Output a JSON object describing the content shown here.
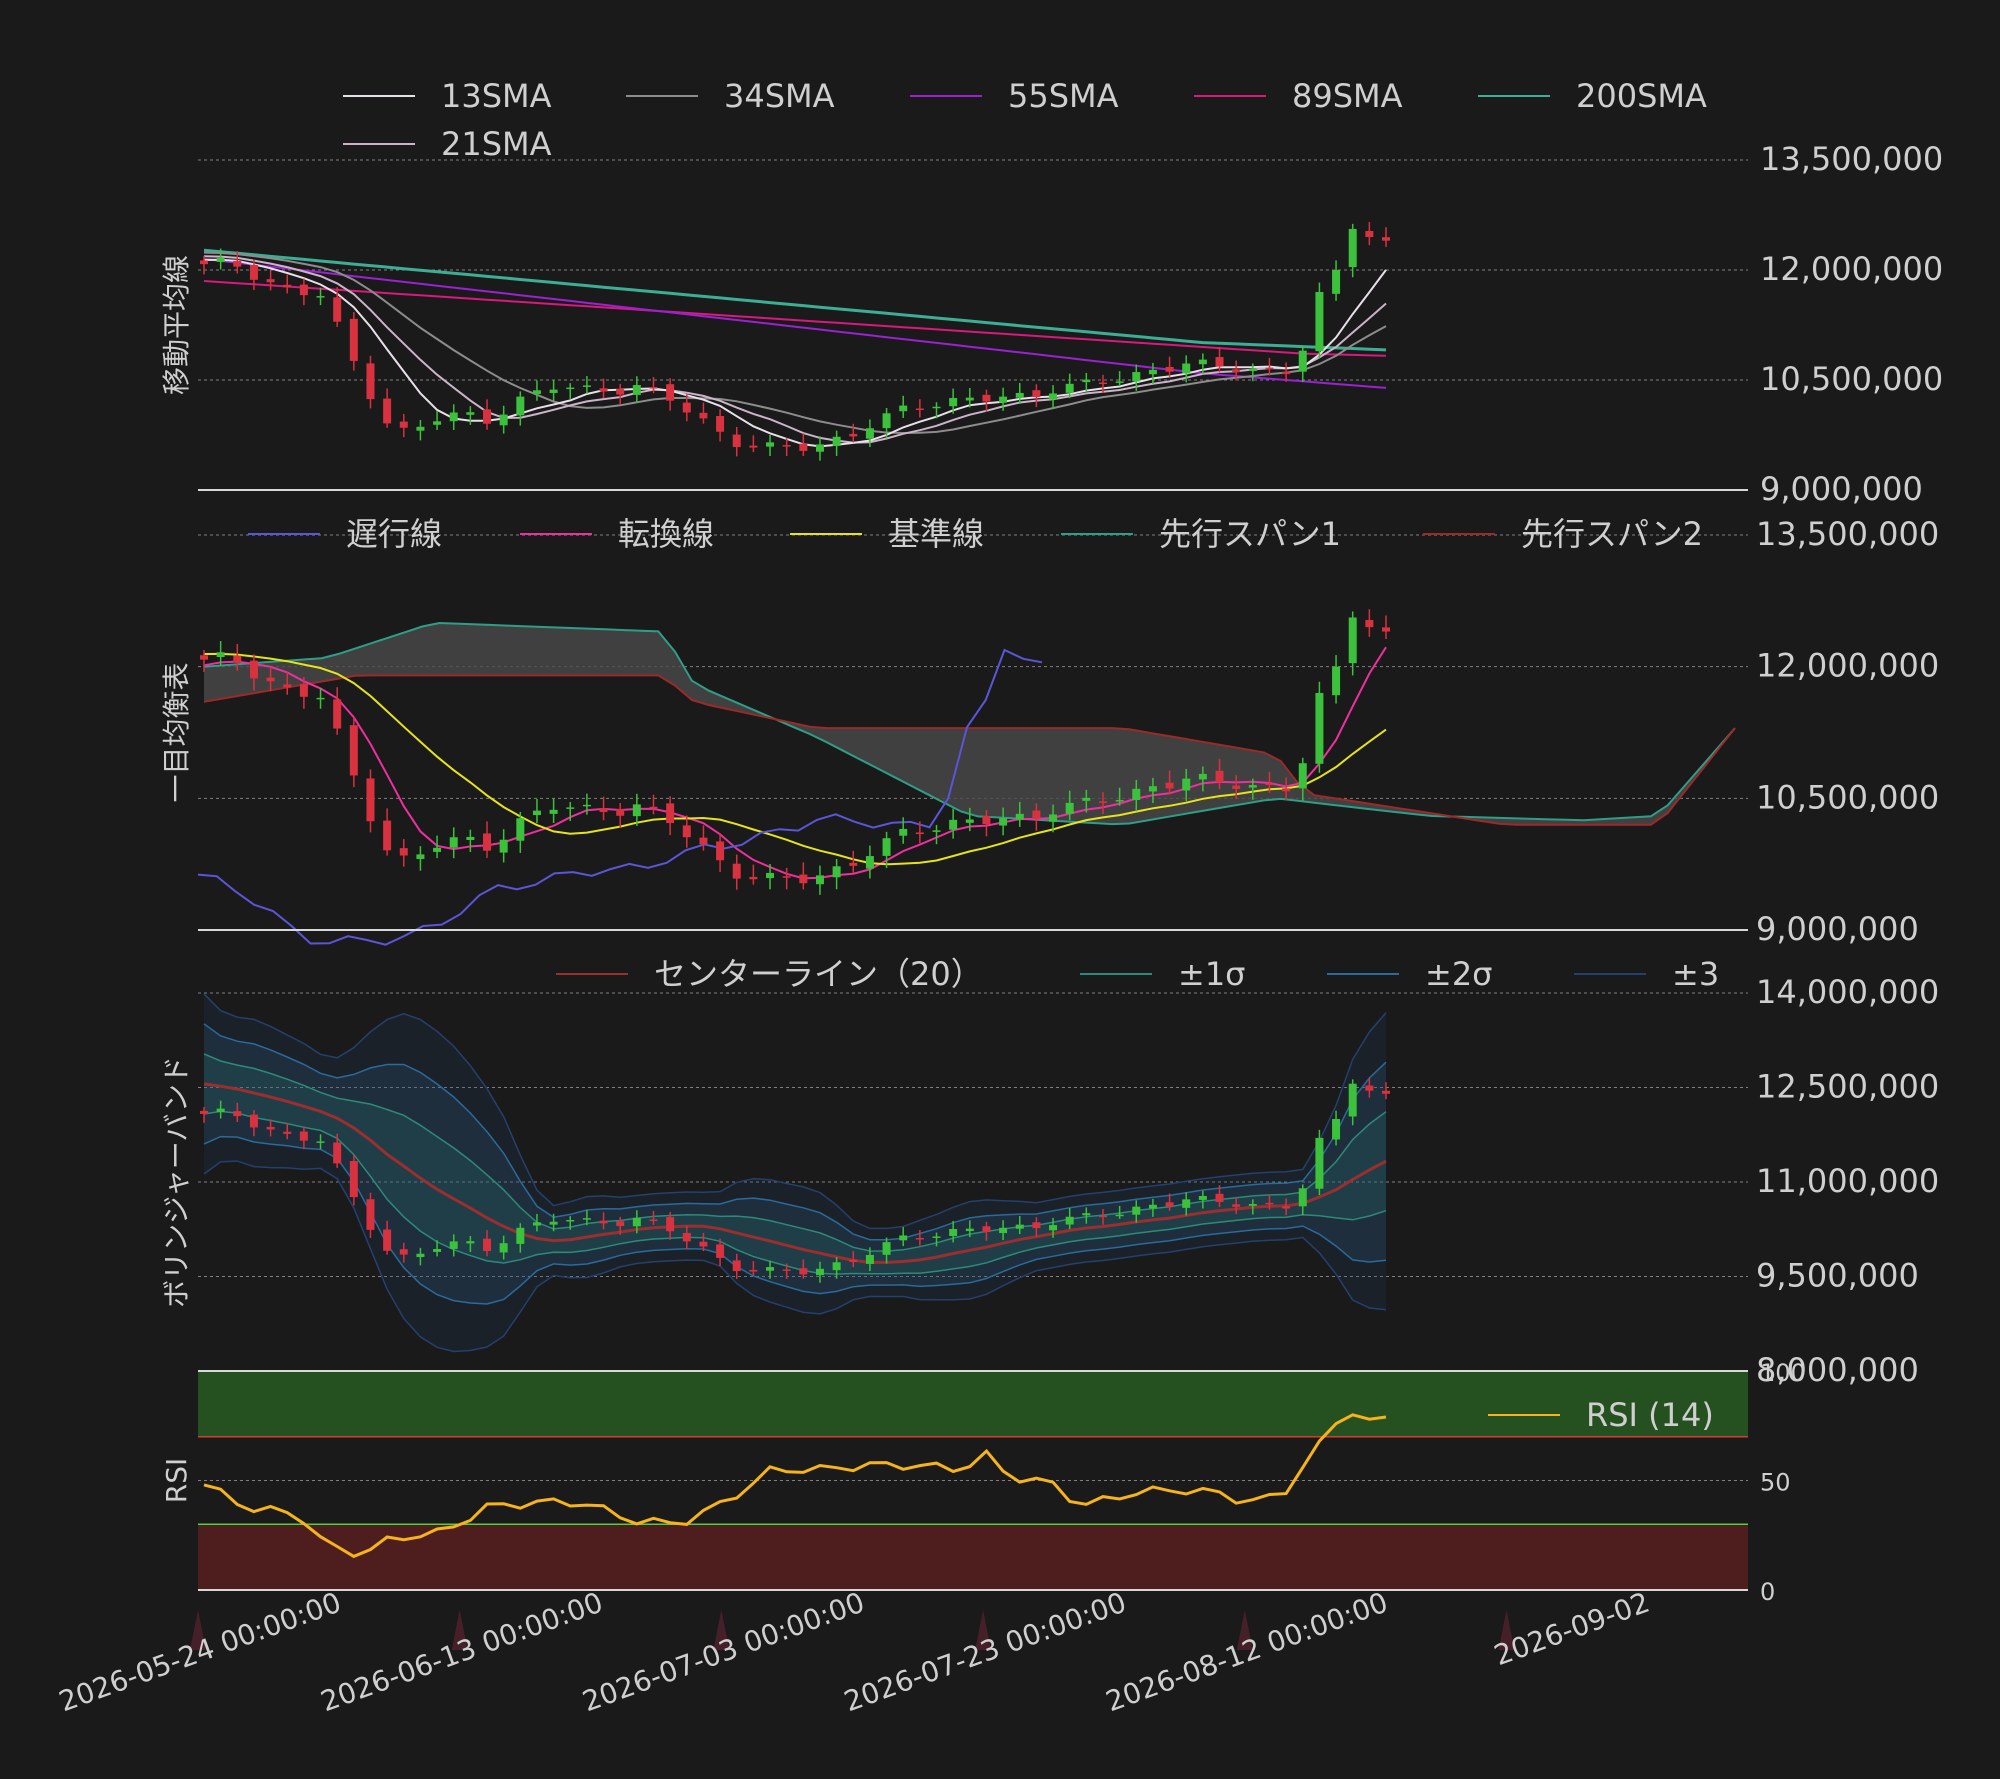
{
  "colors": {
    "background": "#1a1a1a",
    "text": "#cfcfcf",
    "grid": "#9a9a9a",
    "up": "#3cc13c",
    "down": "#d8313f",
    "sma13": "#e8e0e8",
    "sma21": "#cbb4c8",
    "sma34": "#8c8c8c",
    "sma55": "#9a22d0",
    "sma89": "#d8197e",
    "sma200": "#3cae94",
    "chikou": "#5b55d8",
    "tenkan": "#ee2f9f",
    "kijun": "#e5e41b",
    "spanA": "#2f9e87",
    "spanB": "#9b2a2a",
    "cloud": "#4a4a4a",
    "bbCenter": "#9b2e2e",
    "bb1": "#2d8a78",
    "bb2": "#2b6a9a",
    "bb3": "#24406e",
    "rsi": "#f6b31b",
    "overbought": "#255020",
    "oversold": "#4e1e1f",
    "obLine": "#d04030",
    "osLine": "#4ed040"
  },
  "chart_data": [
    {
      "type": "candlestick",
      "panel": "sma",
      "ylabel": "移動平均線",
      "ylim": [
        9000000,
        13500000
      ],
      "yticks": [
        "13,500,000",
        "12,000,000",
        "10,500,000",
        "9,000,000"
      ],
      "ytick_values": [
        13500000,
        12000000,
        10500000,
        9000000
      ],
      "legend": [
        {
          "key": "sma13",
          "label": "13SMA"
        },
        {
          "key": "sma34",
          "label": "34SMA"
        },
        {
          "key": "sma55",
          "label": "55SMA"
        },
        {
          "key": "sma89",
          "label": "89SMA"
        },
        {
          "key": "sma200",
          "label": "200SMA"
        },
        {
          "key": "sma21",
          "label": "21SMA"
        }
      ]
    },
    {
      "type": "candlestick",
      "panel": "ichimoku",
      "ylabel": "一目均衡表",
      "ylim": [
        9000000,
        13500000
      ],
      "yticks": [
        "13,500,000",
        "12,000,000",
        "10,500,000",
        "9,000,000"
      ],
      "ytick_values": [
        13500000,
        12000000,
        10500000,
        9000000
      ],
      "legend": [
        {
          "key": "chikou",
          "label": "遅行線"
        },
        {
          "key": "tenkan",
          "label": "転換線"
        },
        {
          "key": "kijun",
          "label": "基準線"
        },
        {
          "key": "spanA",
          "label": "先行スパン1"
        },
        {
          "key": "spanB",
          "label": "先行スパン2"
        }
      ]
    },
    {
      "type": "candlestick",
      "panel": "bollinger",
      "ylabel": "ボリンジャーバンド",
      "ylim": [
        8000000,
        14000000
      ],
      "yticks": [
        "14,000,000",
        "12,500,000",
        "11,000,000",
        "9,500,000",
        "8,000,000"
      ],
      "ytick_values": [
        14000000,
        12500000,
        11000000,
        9500000,
        8000000
      ],
      "legend": [
        {
          "key": "bbCenter",
          "label": "センターライン（20）"
        },
        {
          "key": "bb1",
          "label": "±1σ"
        },
        {
          "key": "bb2",
          "label": "±2σ"
        },
        {
          "key": "bb3",
          "label": "±3"
        }
      ]
    },
    {
      "type": "line",
      "panel": "rsi",
      "ylabel": "RSI",
      "ylim": [
        0,
        100
      ],
      "yticks": [
        "100",
        "50",
        "0"
      ],
      "ytick_values": [
        100,
        50,
        0
      ],
      "legend": [
        {
          "key": "rsi",
          "label": "RSI (14)"
        }
      ],
      "overbought": 70,
      "oversold": 30
    }
  ],
  "x_axis": {
    "labels": [
      "2026-05-24 00:00:00",
      "2026-06-13 00:00:00",
      "2026-07-03 00:00:00",
      "2026-07-23 00:00:00",
      "2026-08-12 00:00:00",
      "2026-09-02"
    ]
  }
}
